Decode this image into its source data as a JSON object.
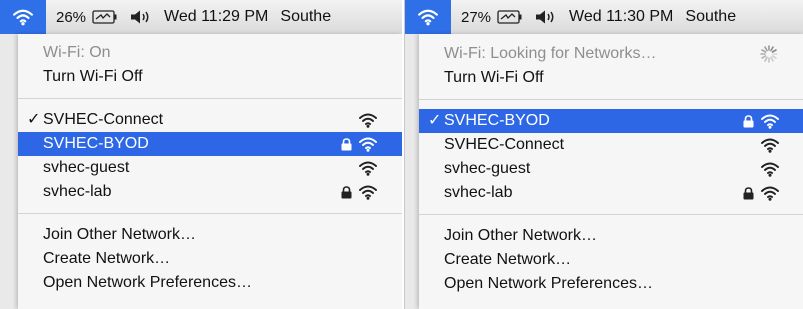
{
  "left": {
    "menubar": {
      "battery_pct": "26%",
      "clock": "Wed 11:29 PM",
      "user": "Southe"
    },
    "status": "Wi-Fi: On",
    "toggle": "Turn Wi-Fi Off",
    "networks": [
      {
        "name": "SVHEC-Connect",
        "checked": true,
        "locked": false,
        "selected": false
      },
      {
        "name": "SVHEC-BYOD",
        "checked": false,
        "locked": true,
        "selected": true
      },
      {
        "name": "svhec-guest",
        "checked": false,
        "locked": false,
        "selected": false
      },
      {
        "name": "svhec-lab",
        "checked": false,
        "locked": true,
        "selected": false
      }
    ],
    "actions": [
      "Join Other Network…",
      "Create Network…",
      "Open Network Preferences…"
    ]
  },
  "right": {
    "menubar": {
      "battery_pct": "27%",
      "clock": "Wed 11:30 PM",
      "user": "Southe"
    },
    "status": "Wi-Fi: Looking for Networks…",
    "toggle": "Turn Wi-Fi Off",
    "networks": [
      {
        "name": "SVHEC-BYOD",
        "checked": true,
        "locked": true,
        "selected": true
      },
      {
        "name": "SVHEC-Connect",
        "checked": false,
        "locked": false,
        "selected": false
      },
      {
        "name": "svhec-guest",
        "checked": false,
        "locked": false,
        "selected": false
      },
      {
        "name": "svhec-lab",
        "checked": false,
        "locked": true,
        "selected": false
      }
    ],
    "actions": [
      "Join Other Network…",
      "Create Network…",
      "Open Network Preferences…"
    ]
  },
  "symbols": {
    "checkmark": "✓"
  },
  "icons": {
    "status_wifi": "wifi-icon",
    "battery": "battery-icon",
    "volume": "volume-icon",
    "lock": "lock-icon",
    "signal": "wifi-signal-icon",
    "spinner": "spinner-icon"
  },
  "colors": {
    "selection": "#2d67e6",
    "menu_bg": "#f6f6f6",
    "disabled_text": "#8e8e8e",
    "status_highlight": "#2f6fe8"
  }
}
